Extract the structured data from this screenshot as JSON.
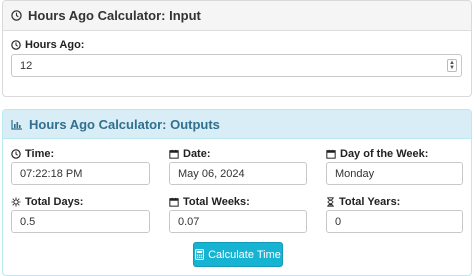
{
  "input_panel": {
    "title": "Hours Ago Calculator: Input",
    "hours_ago": {
      "label": "Hours Ago:",
      "value": "12"
    }
  },
  "output_panel": {
    "title": "Hours Ago Calculator: Outputs",
    "time": {
      "label": "Time:",
      "value": "07:22:18 PM"
    },
    "date": {
      "label": "Date:",
      "value": "May 06, 2024"
    },
    "day_of_week": {
      "label": "Day of the Week:",
      "value": "Monday"
    },
    "total_days": {
      "label": "Total Days:",
      "value": "0.5"
    },
    "total_weeks": {
      "label": "Total Weeks:",
      "value": "0.07"
    },
    "total_years": {
      "label": "Total Years:",
      "value": "0"
    },
    "calculate_button": "Calculate Time"
  },
  "colors": {
    "output_heading_bg": "#d9edf7",
    "output_heading_text": "#31708f",
    "button_bg": "#17b3d3"
  },
  "icons": {
    "input_heading": "clock-icon",
    "output_heading": "bar-chart-icon",
    "time": "clock-icon",
    "date": "calendar-icon",
    "day_of_week": "calendar-icon",
    "total_days": "sun-icon",
    "total_weeks": "calendar-icon",
    "total_years": "hourglass-icon",
    "button": "calculator-icon"
  }
}
